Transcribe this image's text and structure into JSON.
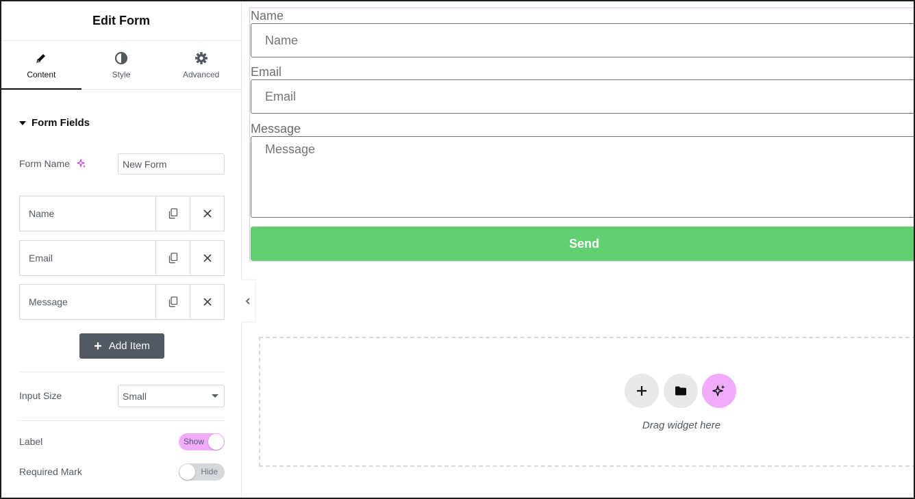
{
  "panel": {
    "title": "Edit Form",
    "tabs": [
      {
        "label": "Content",
        "icon": "pencil-icon",
        "active": true
      },
      {
        "label": "Style",
        "icon": "contrast-icon",
        "active": false
      },
      {
        "label": "Advanced",
        "icon": "gear-icon",
        "active": false
      }
    ],
    "section_title": "Form Fields",
    "form_name": {
      "label": "Form Name",
      "value": "New Form"
    },
    "fields": [
      {
        "label": "Name"
      },
      {
        "label": "Email"
      },
      {
        "label": "Message"
      }
    ],
    "add_item_label": "Add Item",
    "input_size": {
      "label": "Input Size",
      "value": "Small"
    },
    "label_toggle": {
      "label": "Label",
      "state": "Show"
    },
    "required_toggle": {
      "label": "Required Mark",
      "state": "Hide"
    }
  },
  "preview": {
    "fields": [
      {
        "label": "Name",
        "placeholder": "Name"
      },
      {
        "label": "Email",
        "placeholder": "Email"
      },
      {
        "label": "Message",
        "placeholder": "Message"
      }
    ],
    "send_label": "Send",
    "drop_zone_text": "Drag widget here"
  },
  "colors": {
    "accent_pink": "#f0abfc",
    "send_green": "#61ce70",
    "panel_text": "#515962",
    "button_dark": "#515962"
  }
}
